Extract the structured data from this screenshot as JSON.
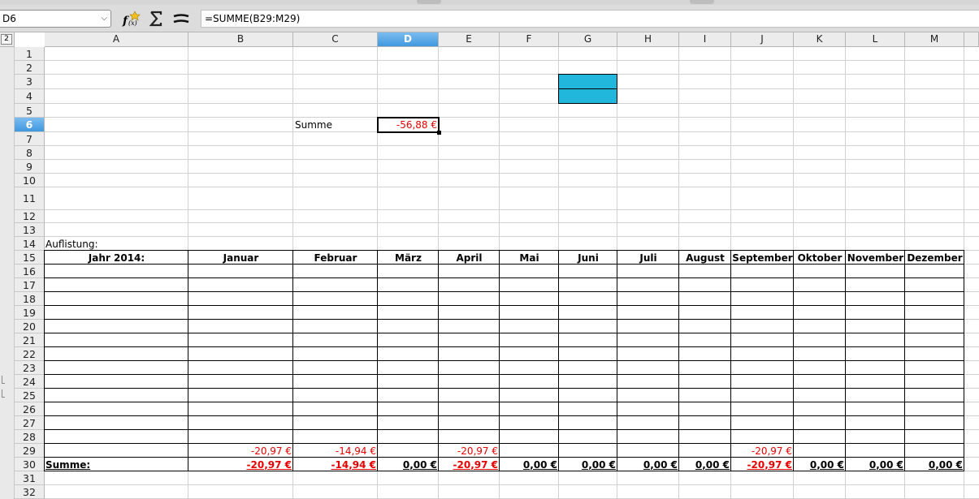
{
  "namebox": {
    "value": "D6"
  },
  "formula": {
    "value": "=SUMME(B29:M29)"
  },
  "icons": {
    "function_wizard": "function-wizard-icon",
    "sum": "sigma-icon",
    "equals": "equals-icon"
  },
  "outline_level": "2",
  "selected_column": "D",
  "selected_row": "6",
  "columns": [
    "A",
    "B",
    "C",
    "D",
    "E",
    "F",
    "G",
    "H",
    "I",
    "J",
    "K",
    "L",
    "M"
  ],
  "rows": [
    "1",
    "2",
    "3",
    "4",
    "5",
    "6",
    "7",
    "8",
    "9",
    "10",
    "11",
    "12",
    "13",
    "14",
    "15",
    "16",
    "17",
    "18",
    "19",
    "20",
    "21",
    "22",
    "23",
    "24",
    "25",
    "26",
    "27",
    "28",
    "29",
    "30",
    "31",
    "32"
  ],
  "cells": {
    "summe_label": "Summe",
    "summe_value": "-56,88 €",
    "auflistung": "Auflistung:",
    "year_header": "Jahr 2014:",
    "months": [
      "Januar",
      "Februar",
      "März",
      "April",
      "Mai",
      "Juni",
      "Juli",
      "August",
      "September",
      "Oktober",
      "November",
      "Dezember"
    ],
    "row29": [
      "-20,97 €",
      "-14,94 €",
      "",
      "-20,97 €",
      "",
      "",
      "",
      "",
      "-20,97 €",
      "",
      "",
      ""
    ],
    "row30_label": "Summe:",
    "row30": [
      "-20,97 €",
      "-14,94 €",
      "0,00 €",
      "-20,97 €",
      "0,00 €",
      "0,00 €",
      "0,00 €",
      "0,00 €",
      "-20,97 €",
      "0,00 €",
      "0,00 €",
      "0,00 €"
    ]
  },
  "colors": {
    "accent_blue": "#21b6dc",
    "negative_red": "#e60000",
    "selection": "#5aa9e6"
  }
}
